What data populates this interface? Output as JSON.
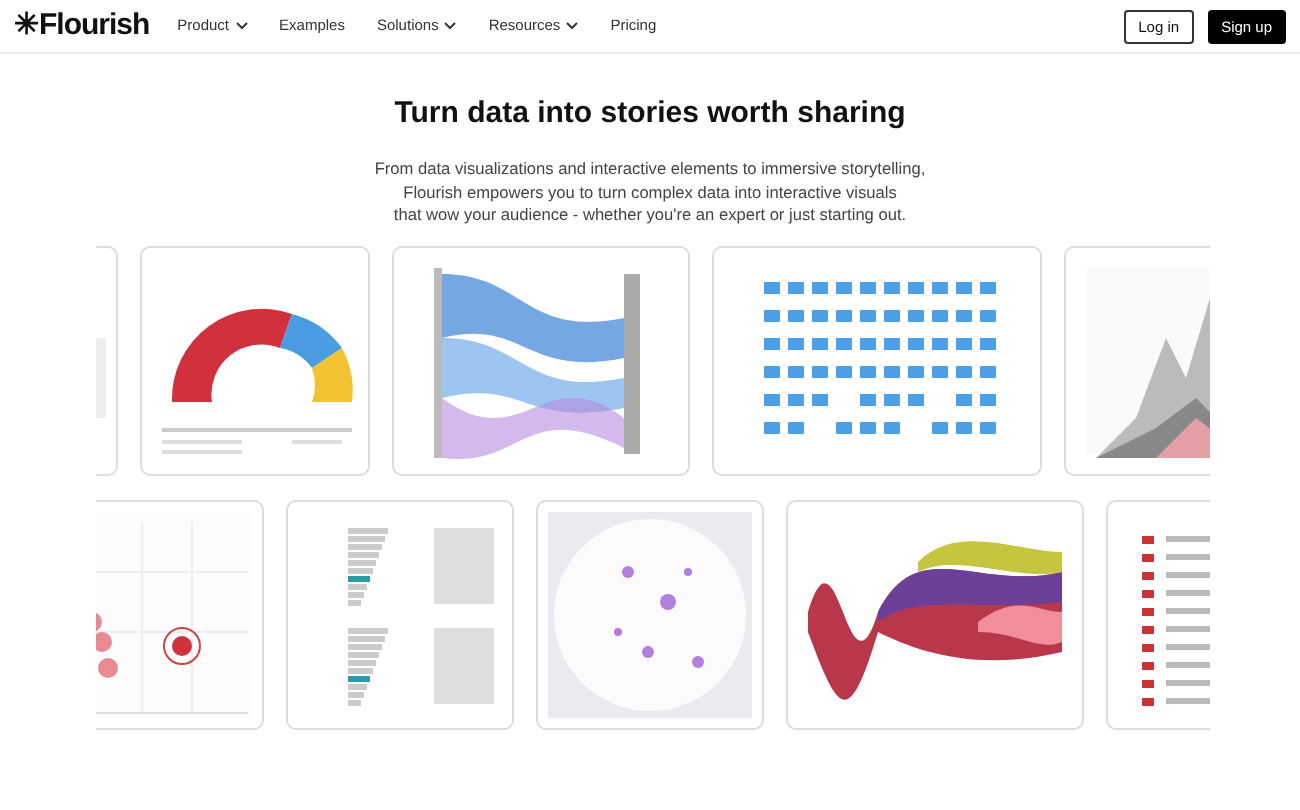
{
  "navbar": {
    "logo": "✳Flourish",
    "menu": [
      {
        "label": "Product",
        "dropdown": true
      },
      {
        "label": "Examples",
        "dropdown": false
      },
      {
        "label": "Solutions",
        "dropdown": true
      },
      {
        "label": "Resources",
        "dropdown": true
      },
      {
        "label": "Pricing",
        "dropdown": false
      }
    ],
    "login": "Log in",
    "signup": "Sign up"
  },
  "hero": {
    "title": "Turn data into stories worth sharing",
    "lines": [
      "From data visualizations and interactive elements to immersive storytelling,",
      "Flourish empowers you to turn complex data into interactive visuals",
      "that wow your audience - whether you're an expert or just starting out."
    ]
  }
}
